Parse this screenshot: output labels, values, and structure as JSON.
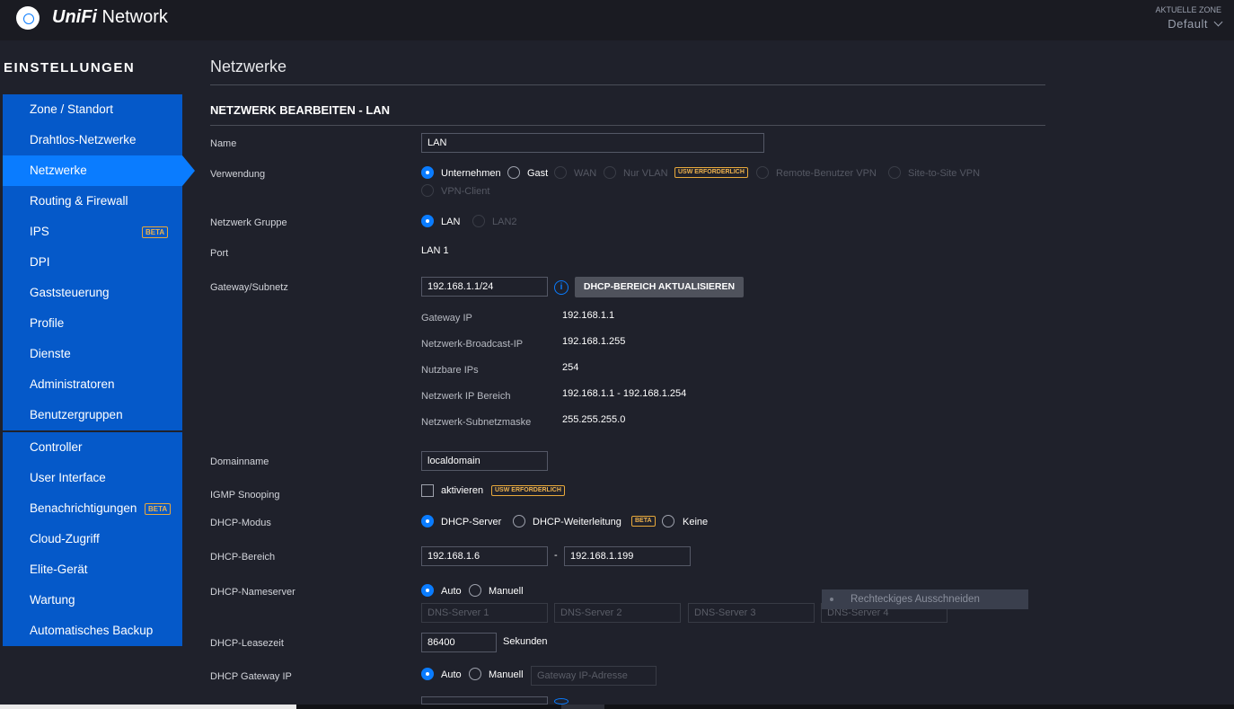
{
  "header": {
    "brand_prefix": "UniFi",
    "brand_suffix": " Network",
    "zone_label": "AKTUELLE ZONE",
    "zone_value": "Default"
  },
  "sidebar": {
    "title": "EINSTELLUNGEN",
    "group_a": [
      {
        "label": "Zone / Standort"
      },
      {
        "label": "Drahtlos-Netzwerke"
      },
      {
        "label": "Netzwerke",
        "active": true
      },
      {
        "label": "Routing & Firewall"
      },
      {
        "label": "IPS",
        "badge": "BETA"
      },
      {
        "label": "DPI"
      },
      {
        "label": "Gaststeuerung"
      },
      {
        "label": "Profile"
      },
      {
        "label": "Dienste"
      },
      {
        "label": "Administratoren"
      },
      {
        "label": "Benutzergruppen"
      }
    ],
    "group_b": [
      {
        "label": "Controller"
      },
      {
        "label": "User Interface"
      },
      {
        "label": "Benachrichtigungen",
        "badge": "BETA"
      },
      {
        "label": "Cloud-Zugriff"
      },
      {
        "label": "Elite-Gerät"
      },
      {
        "label": "Wartung"
      },
      {
        "label": "Automatisches Backup"
      }
    ]
  },
  "main": {
    "page_title": "Netzwerke",
    "section_title": "NETZWERK BEARBEITEN - LAN",
    "name": {
      "label": "Name",
      "value": "LAN"
    },
    "usage": {
      "label": "Verwendung",
      "options": [
        "Unternehmen",
        "Gast",
        "WAN",
        "Nur VLAN",
        "Remote-Benutzer VPN",
        "Site-to-Site VPN",
        "VPN-Client"
      ],
      "selected": "Unternehmen",
      "badge": "USW ERFORDERLICH"
    },
    "group": {
      "label": "Netzwerk Gruppe",
      "options": [
        "LAN",
        "LAN2"
      ],
      "selected": "LAN"
    },
    "port": {
      "label": "Port",
      "value": "LAN 1"
    },
    "gateway": {
      "label": "Gateway/Subnetz",
      "value": "192.168.1.1/24",
      "info_glyph": "i",
      "button": "DHCP-BEREICH AKTUALISIEREN",
      "details": [
        {
          "label": "Gateway IP",
          "value": "192.168.1.1"
        },
        {
          "label": "Netzwerk-Broadcast-IP",
          "value": "192.168.1.255"
        },
        {
          "label": "Nutzbare IPs",
          "value": "254"
        },
        {
          "label": "Netzwerk IP Bereich",
          "value": "192.168.1.1 - 192.168.1.254"
        },
        {
          "label": "Netzwerk-Subnetzmaske",
          "value": "255.255.255.0"
        }
      ]
    },
    "domain": {
      "label": "Domainname",
      "value": "localdomain"
    },
    "igmp": {
      "label": "IGMP Snooping",
      "option": "aktivieren",
      "badge": "USW ERFORDERLICH"
    },
    "dhcp_mode": {
      "label": "DHCP-Modus",
      "options": [
        "DHCP-Server",
        "DHCP-Weiterleitung",
        "Keine"
      ],
      "selected": "DHCP-Server",
      "badge": "BETA"
    },
    "dhcp_range": {
      "label": "DHCP-Bereich",
      "start": "192.168.1.6",
      "separator": "-",
      "end": "192.168.1.199"
    },
    "dhcp_ns": {
      "label": "DHCP-Nameserver",
      "options": [
        "Auto",
        "Manuell"
      ],
      "selected": "Auto",
      "placeholders": [
        "DNS-Server 1",
        "DNS-Server 2",
        "DNS-Server 3",
        "DNS-Server 4"
      ]
    },
    "lease": {
      "label": "DHCP-Leasezeit",
      "value": "86400",
      "unit": "Sekunden"
    },
    "dhcp_gw": {
      "label": "DHCP Gateway IP",
      "options": [
        "Auto",
        "Manuell"
      ],
      "selected": "Auto",
      "placeholder": "Gateway IP-Adresse"
    }
  },
  "overlay": {
    "label": "Rechteckiges Ausschneiden"
  },
  "colors": {
    "accent": "#0a7cff",
    "sidebar": "#0559c9",
    "badge": "#f0b34d",
    "background": "#1f212b"
  }
}
